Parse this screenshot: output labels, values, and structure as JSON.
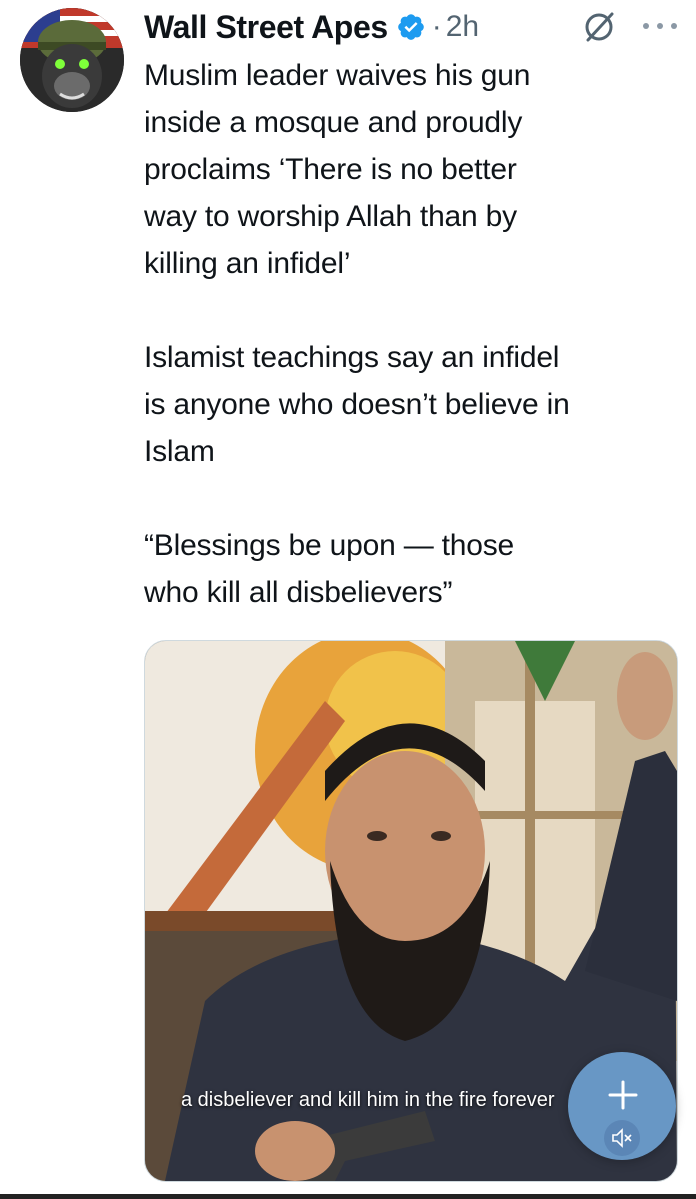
{
  "post": {
    "author": {
      "display_name": "Wall Street Apes",
      "verified": true,
      "avatar_icon": "gorilla-soldier-avatar"
    },
    "separator": "·",
    "timestamp": "2h",
    "grok_icon": "grok-icon",
    "more_icon": "more-options-icon",
    "text": "Muslim leader waives his gun\ninside a mosque and proudly\nproclaims ‘There is no better\nway to worship Allah than by\nkilling an infidel’\n\nIslamist teachings say an infidel\nis anyone who doesn’t believe in\nIslam\n\n“Blessings be upon — those\nwho kill all disbelievers”",
    "video": {
      "caption": "a disbeliever and kill him in the fire forever",
      "mute_icon": "volume-muted-icon",
      "compose_icon": "plus-icon"
    }
  },
  "colors": {
    "accent": "#1d9bf0",
    "text_primary": "#0f1419",
    "text_secondary": "#536471",
    "fab": "#78b4eb"
  }
}
